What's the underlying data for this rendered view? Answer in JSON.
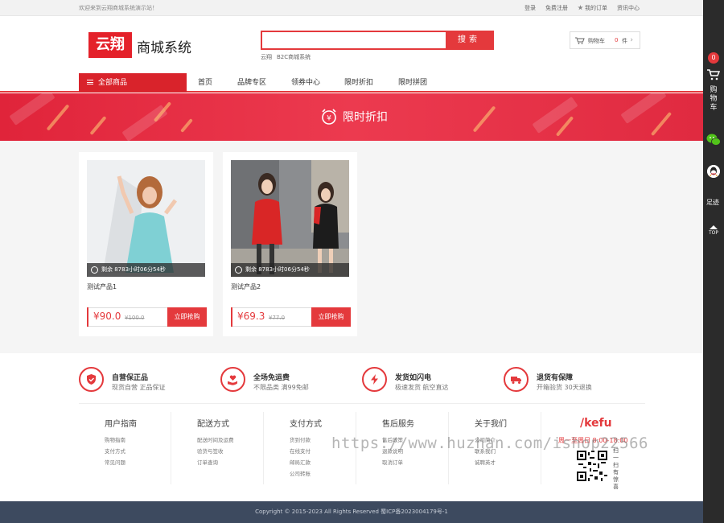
{
  "topbar": {
    "welcome": "欢迎来到云翔商城系统演示站！",
    "login": "登录",
    "register": "免费注册",
    "my_orders": "我的订单",
    "news": "资讯中心"
  },
  "header": {
    "logo_mark": "云翔",
    "logo_text": "商城系统",
    "search_placeholder": "",
    "search_button": "搜索",
    "hot_words": [
      "云翔",
      "B2C商城系统"
    ],
    "cart_label": "购物车",
    "cart_count": "0",
    "cart_unit": "件"
  },
  "nav": {
    "all_categories": "全部商品",
    "items": [
      "首页",
      "品牌专区",
      "领券中心",
      "限时折扣",
      "限时拼团"
    ]
  },
  "banner": {
    "title": "限时折扣"
  },
  "products": [
    {
      "name": "测试产品1",
      "price": "¥90.0",
      "old_price": "¥100.0",
      "countdown": "剩余 8783小时06分54秒",
      "buy_label": "立即抢购"
    },
    {
      "name": "测试产品2",
      "price": "¥69.3",
      "old_price": "¥77.0",
      "countdown": "剩余 8783小时06分54秒",
      "buy_label": "立即抢购"
    }
  ],
  "services": [
    {
      "title": "自营保正品",
      "desc": "现货自营 正品保证",
      "icon": "shield-check-icon"
    },
    {
      "title": "全场免运费",
      "desc": "不限品类 满99免邮",
      "icon": "hand-heart-icon"
    },
    {
      "title": "发货如闪电",
      "desc": "极速发货 航空直达",
      "icon": "lightning-icon"
    },
    {
      "title": "退货有保障",
      "desc": "开箱验货 30天退换",
      "icon": "truck-icon"
    }
  ],
  "footer_columns": [
    {
      "title": "用户指南",
      "items": [
        "购物指南",
        "支付方式",
        "常见问题"
      ]
    },
    {
      "title": "配送方式",
      "items": [
        "配送时间及运费",
        "验货与签收",
        "订单查询"
      ]
    },
    {
      "title": "支付方式",
      "items": [
        "货到付款",
        "在线支付",
        "邮局汇款",
        "公司转账"
      ]
    },
    {
      "title": "售后服务",
      "items": [
        "售后政策",
        "退款说明",
        "取消订单"
      ]
    },
    {
      "title": "关于我们",
      "items": [
        "公司简介",
        "联系我们",
        "诚聘英才"
      ]
    }
  ],
  "kefu": {
    "title": "/kefu",
    "hours": "周一至周日 8:00-18:00",
    "qr_note": "扫一扫有惊喜"
  },
  "watermark": "https://www.huzhan.com/ishop22566",
  "copyright": "Copyright © 2015-2023 All Rights Reserved 蜀ICP备2023004179号-1",
  "dock": {
    "cart_badge": "0",
    "cart_label": "购物车",
    "track_label": "足迹",
    "top_label": "TOP"
  },
  "colors": {
    "accent": "#e4393c",
    "dock": "#2b2b2b",
    "footer": "#3d4a5f"
  }
}
